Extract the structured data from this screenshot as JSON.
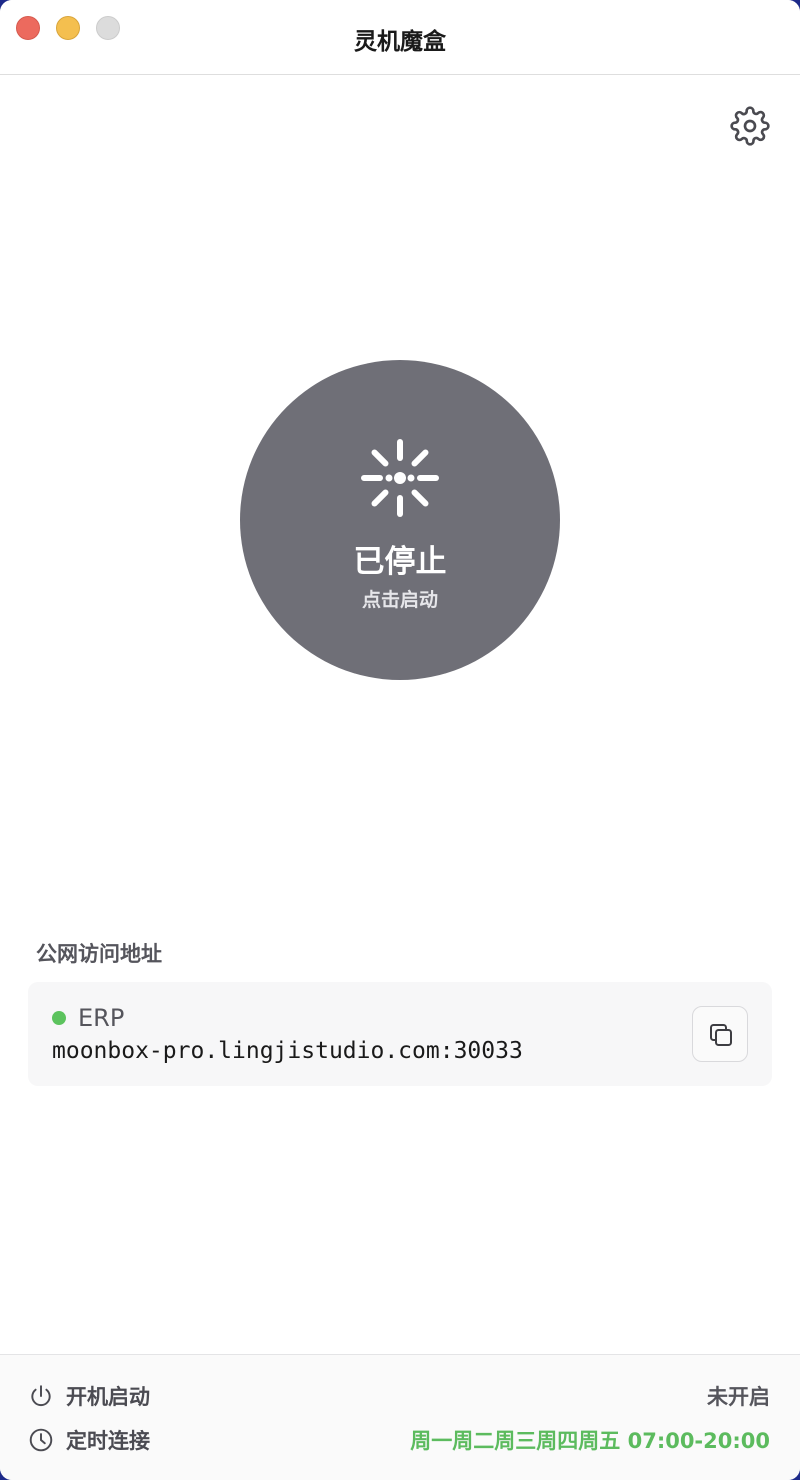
{
  "window": {
    "title": "灵机魔盒"
  },
  "toolbar": {
    "settings_icon": "gear-icon"
  },
  "status": {
    "main": "已停止",
    "sub": "点击启动",
    "icon": "loading-spinner-icon",
    "button_color": "#6f6f77"
  },
  "public_address": {
    "section_label": "公网访问地址",
    "items": [
      {
        "name": "ERP",
        "url": "moonbox-pro.lingjistudio.com:30033",
        "status_color": "#5cc35e",
        "copy_icon": "copy-icon"
      }
    ]
  },
  "settings": {
    "auto_start": {
      "label": "开机启动",
      "value": "未开启",
      "icon": "power-icon"
    },
    "scheduled": {
      "label": "定时连接",
      "value": "周一周二周三周四周五 07:00-20:00",
      "icon": "clock-icon",
      "value_color": "#5cbb5e"
    }
  }
}
